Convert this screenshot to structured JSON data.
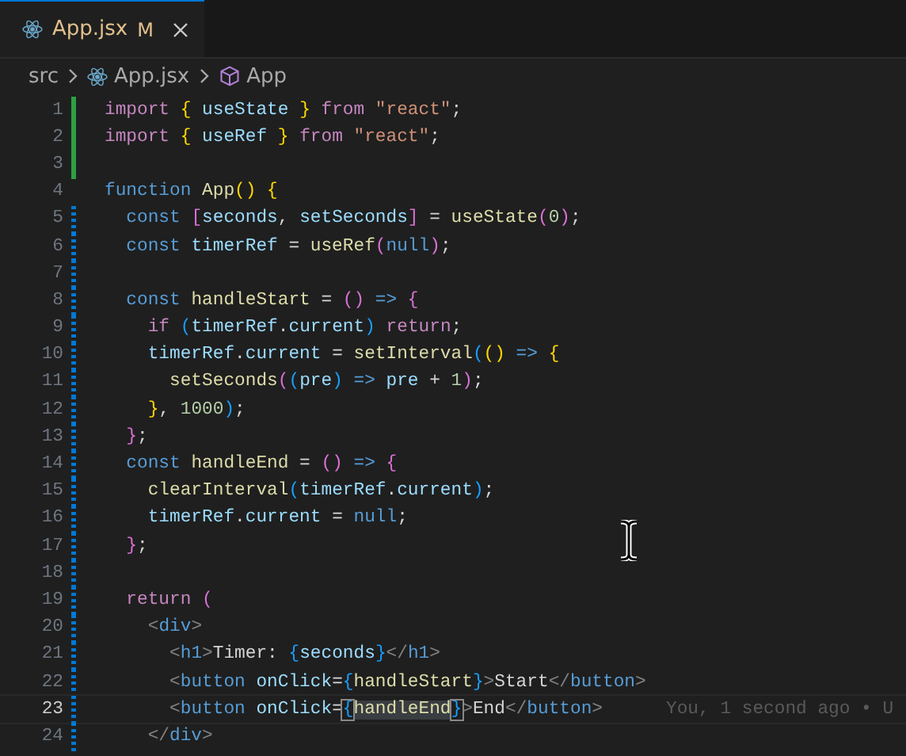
{
  "tab": {
    "label": "App.jsx",
    "status": "M",
    "modified": true,
    "active": true
  },
  "breadcrumb": [
    {
      "label": "src",
      "kind": "folder"
    },
    {
      "label": "App.jsx",
      "kind": "file"
    },
    {
      "label": "App",
      "kind": "symbol"
    }
  ],
  "blame": "You, 1 second ago • U",
  "lines": [
    {
      "n": "1",
      "kind": "added",
      "selected": false,
      "tokens": [
        {
          "text": "import ",
          "kind": "kw"
        },
        {
          "text": "{",
          "kind": "b1"
        },
        {
          "text": " useState ",
          "kind": "var"
        },
        {
          "text": "}",
          "kind": "b1"
        },
        {
          "text": " from ",
          "kind": "kw"
        },
        {
          "text": "\"react\"",
          "kind": "str"
        },
        {
          "text": ";",
          "kind": "p"
        }
      ]
    },
    {
      "n": "2",
      "kind": "added",
      "selected": false,
      "tokens": [
        {
          "text": "import ",
          "kind": "kw"
        },
        {
          "text": "{",
          "kind": "b1"
        },
        {
          "text": " useRef ",
          "kind": "var"
        },
        {
          "text": "}",
          "kind": "b1"
        },
        {
          "text": " from ",
          "kind": "kw"
        },
        {
          "text": "\"react\"",
          "kind": "str"
        },
        {
          "text": ";",
          "kind": "p"
        }
      ]
    },
    {
      "n": "3",
      "kind": "added",
      "selected": false
    },
    {
      "n": "4",
      "kind": "none",
      "selected": false,
      "tokens": [
        {
          "text": "function ",
          "kind": "st"
        },
        {
          "text": "App",
          "kind": "fn"
        },
        {
          "text": "() {",
          "kind": "b1"
        }
      ]
    },
    {
      "n": "5",
      "kind": "modified",
      "selected": false,
      "tokens": [
        {
          "text": "  const ",
          "kind": "st"
        },
        {
          "text": "[",
          "kind": "b2"
        },
        {
          "text": "seconds",
          "kind": "var"
        },
        {
          "text": ", ",
          "kind": "p"
        },
        {
          "text": "setSeconds",
          "kind": "var"
        },
        {
          "text": "]",
          "kind": "b2"
        },
        {
          "text": " = ",
          "kind": "p"
        },
        {
          "text": "useState",
          "kind": "fn"
        },
        {
          "text": "(",
          "kind": "b2"
        },
        {
          "text": "0",
          "kind": "num"
        },
        {
          "text": ")",
          "kind": "b2"
        },
        {
          "text": ";",
          "kind": "p"
        }
      ]
    },
    {
      "n": "6",
      "kind": "modified",
      "selected": false,
      "tokens": [
        {
          "text": "  const ",
          "kind": "st"
        },
        {
          "text": "timerRef",
          "kind": "var"
        },
        {
          "text": " = ",
          "kind": "p"
        },
        {
          "text": "useRef",
          "kind": "fn"
        },
        {
          "text": "(",
          "kind": "b2"
        },
        {
          "text": "null",
          "kind": "st"
        },
        {
          "text": ")",
          "kind": "b2"
        },
        {
          "text": ";",
          "kind": "p"
        }
      ]
    },
    {
      "n": "7",
      "kind": "modified",
      "selected": false
    },
    {
      "n": "8",
      "kind": "modified",
      "selected": false,
      "tokens": [
        {
          "text": "  const ",
          "kind": "st"
        },
        {
          "text": "handleStart",
          "kind": "fn"
        },
        {
          "text": " = ",
          "kind": "p"
        },
        {
          "text": "()",
          "kind": "b2"
        },
        {
          "text": " => ",
          "kind": "st"
        },
        {
          "text": "{",
          "kind": "b2"
        }
      ]
    },
    {
      "n": "9",
      "kind": "modified",
      "selected": false,
      "tokens": [
        {
          "text": "    if ",
          "kind": "kw"
        },
        {
          "text": "(",
          "kind": "b3"
        },
        {
          "text": "timerRef",
          "kind": "var"
        },
        {
          "text": ".",
          "kind": "p"
        },
        {
          "text": "current",
          "kind": "var"
        },
        {
          "text": ")",
          "kind": "b3"
        },
        {
          "text": " return",
          "kind": "kw"
        },
        {
          "text": ";",
          "kind": "p"
        }
      ]
    },
    {
      "n": "10",
      "kind": "modified",
      "selected": false,
      "tokens": [
        {
          "text": "    timerRef",
          "kind": "var"
        },
        {
          "text": ".",
          "kind": "p"
        },
        {
          "text": "current",
          "kind": "var"
        },
        {
          "text": " = ",
          "kind": "p"
        },
        {
          "text": "setInterval",
          "kind": "fn"
        },
        {
          "text": "(",
          "kind": "b3"
        },
        {
          "text": "()",
          "kind": "b1"
        },
        {
          "text": " => ",
          "kind": "st"
        },
        {
          "text": "{",
          "kind": "b1"
        }
      ]
    },
    {
      "n": "11",
      "kind": "modified",
      "selected": false,
      "tokens": [
        {
          "text": "      setSeconds",
          "kind": "fn"
        },
        {
          "text": "(",
          "kind": "b2"
        },
        {
          "text": "(",
          "kind": "b3"
        },
        {
          "text": "pre",
          "kind": "var"
        },
        {
          "text": ")",
          "kind": "b3"
        },
        {
          "text": " => ",
          "kind": "st"
        },
        {
          "text": "pre",
          "kind": "var"
        },
        {
          "text": " + ",
          "kind": "p"
        },
        {
          "text": "1",
          "kind": "num"
        },
        {
          "text": ")",
          "kind": "b2"
        },
        {
          "text": ";",
          "kind": "p"
        }
      ]
    },
    {
      "n": "12",
      "kind": "modified",
      "selected": false,
      "tokens": [
        {
          "text": "    }",
          "kind": "b1"
        },
        {
          "text": ", ",
          "kind": "p"
        },
        {
          "text": "1000",
          "kind": "num"
        },
        {
          "text": ")",
          "kind": "b3"
        },
        {
          "text": ";",
          "kind": "p"
        }
      ]
    },
    {
      "n": "13",
      "kind": "modified",
      "selected": false,
      "tokens": [
        {
          "text": "  }",
          "kind": "b2"
        },
        {
          "text": ";",
          "kind": "p"
        }
      ]
    },
    {
      "n": "14",
      "kind": "modified",
      "selected": false,
      "tokens": [
        {
          "text": "  const ",
          "kind": "st"
        },
        {
          "text": "handleEnd",
          "kind": "fn"
        },
        {
          "text": " = ",
          "kind": "p"
        },
        {
          "text": "()",
          "kind": "b2"
        },
        {
          "text": " => ",
          "kind": "st"
        },
        {
          "text": "{",
          "kind": "b2"
        }
      ]
    },
    {
      "n": "15",
      "kind": "modified",
      "selected": false,
      "tokens": [
        {
          "text": "    clearInterval",
          "kind": "fn"
        },
        {
          "text": "(",
          "kind": "b3"
        },
        {
          "text": "timerRef",
          "kind": "var"
        },
        {
          "text": ".",
          "kind": "p"
        },
        {
          "text": "current",
          "kind": "var"
        },
        {
          "text": ")",
          "kind": "b3"
        },
        {
          "text": ";",
          "kind": "p"
        }
      ]
    },
    {
      "n": "16",
      "kind": "modified",
      "selected": false,
      "tokens": [
        {
          "text": "    timerRef",
          "kind": "var"
        },
        {
          "text": ".",
          "kind": "p"
        },
        {
          "text": "current",
          "kind": "var"
        },
        {
          "text": " = ",
          "kind": "p"
        },
        {
          "text": "null",
          "kind": "st"
        },
        {
          "text": ";",
          "kind": "p"
        }
      ]
    },
    {
      "n": "17",
      "kind": "modified",
      "selected": false,
      "tokens": [
        {
          "text": "  }",
          "kind": "b2"
        },
        {
          "text": ";",
          "kind": "p"
        }
      ]
    },
    {
      "n": "18",
      "kind": "modified",
      "selected": false
    },
    {
      "n": "19",
      "kind": "modified",
      "selected": false,
      "tokens": [
        {
          "text": "  return ",
          "kind": "kw"
        },
        {
          "text": "(",
          "kind": "b2"
        }
      ]
    },
    {
      "n": "20",
      "kind": "modified",
      "selected": false,
      "tokens": [
        {
          "text": "    <",
          "kind": "tp"
        },
        {
          "text": "div",
          "kind": "st"
        },
        {
          "text": ">",
          "kind": "tp"
        }
      ]
    },
    {
      "n": "21",
      "kind": "modified",
      "selected": false,
      "tokens": [
        {
          "text": "      <",
          "kind": "tp"
        },
        {
          "text": "h1",
          "kind": "st"
        },
        {
          "text": ">",
          "kind": "tp"
        },
        {
          "text": "Timer: ",
          "kind": "txt"
        },
        {
          "text": "{",
          "kind": "b3"
        },
        {
          "text": "seconds",
          "kind": "var"
        },
        {
          "text": "}",
          "kind": "b3"
        },
        {
          "text": "</",
          "kind": "tp"
        },
        {
          "text": "h1",
          "kind": "st"
        },
        {
          "text": ">",
          "kind": "tp"
        }
      ]
    },
    {
      "n": "22",
      "kind": "modified",
      "selected": false,
      "tokens": [
        {
          "text": "      <",
          "kind": "tp"
        },
        {
          "text": "button",
          "kind": "st"
        },
        {
          "text": " onClick",
          "kind": "var"
        },
        {
          "text": "=",
          "kind": "p"
        },
        {
          "text": "{",
          "kind": "b3"
        },
        {
          "text": "handleStart",
          "kind": "fn"
        },
        {
          "text": "}",
          "kind": "b3"
        },
        {
          "text": ">",
          "kind": "tp"
        },
        {
          "text": "Start",
          "kind": "txt"
        },
        {
          "text": "</",
          "kind": "tp"
        },
        {
          "text": "button",
          "kind": "st"
        },
        {
          "text": ">",
          "kind": "tp"
        }
      ]
    },
    {
      "n": "23",
      "kind": "modified",
      "selected": true,
      "tokens": [
        {
          "text": "      <",
          "kind": "tp"
        },
        {
          "text": "button",
          "kind": "st"
        },
        {
          "text": " onClick",
          "kind": "var"
        },
        {
          "text": "=",
          "kind": "p"
        },
        {
          "text": "{",
          "kind": "match"
        },
        {
          "text": "handleEnd",
          "kind": "hl"
        },
        {
          "text": "}",
          "kind": "match"
        },
        {
          "text": ">",
          "kind": "tp"
        },
        {
          "text": "End",
          "kind": "txt"
        },
        {
          "text": "</",
          "kind": "tp"
        },
        {
          "text": "button",
          "kind": "st"
        },
        {
          "text": ">",
          "kind": "tp"
        }
      ]
    },
    {
      "n": "24",
      "kind": "modified",
      "selected": false,
      "tokens": [
        {
          "text": "    </",
          "kind": "tp"
        },
        {
          "text": "div",
          "kind": "st"
        },
        {
          "text": ">",
          "kind": "tp"
        }
      ]
    }
  ]
}
